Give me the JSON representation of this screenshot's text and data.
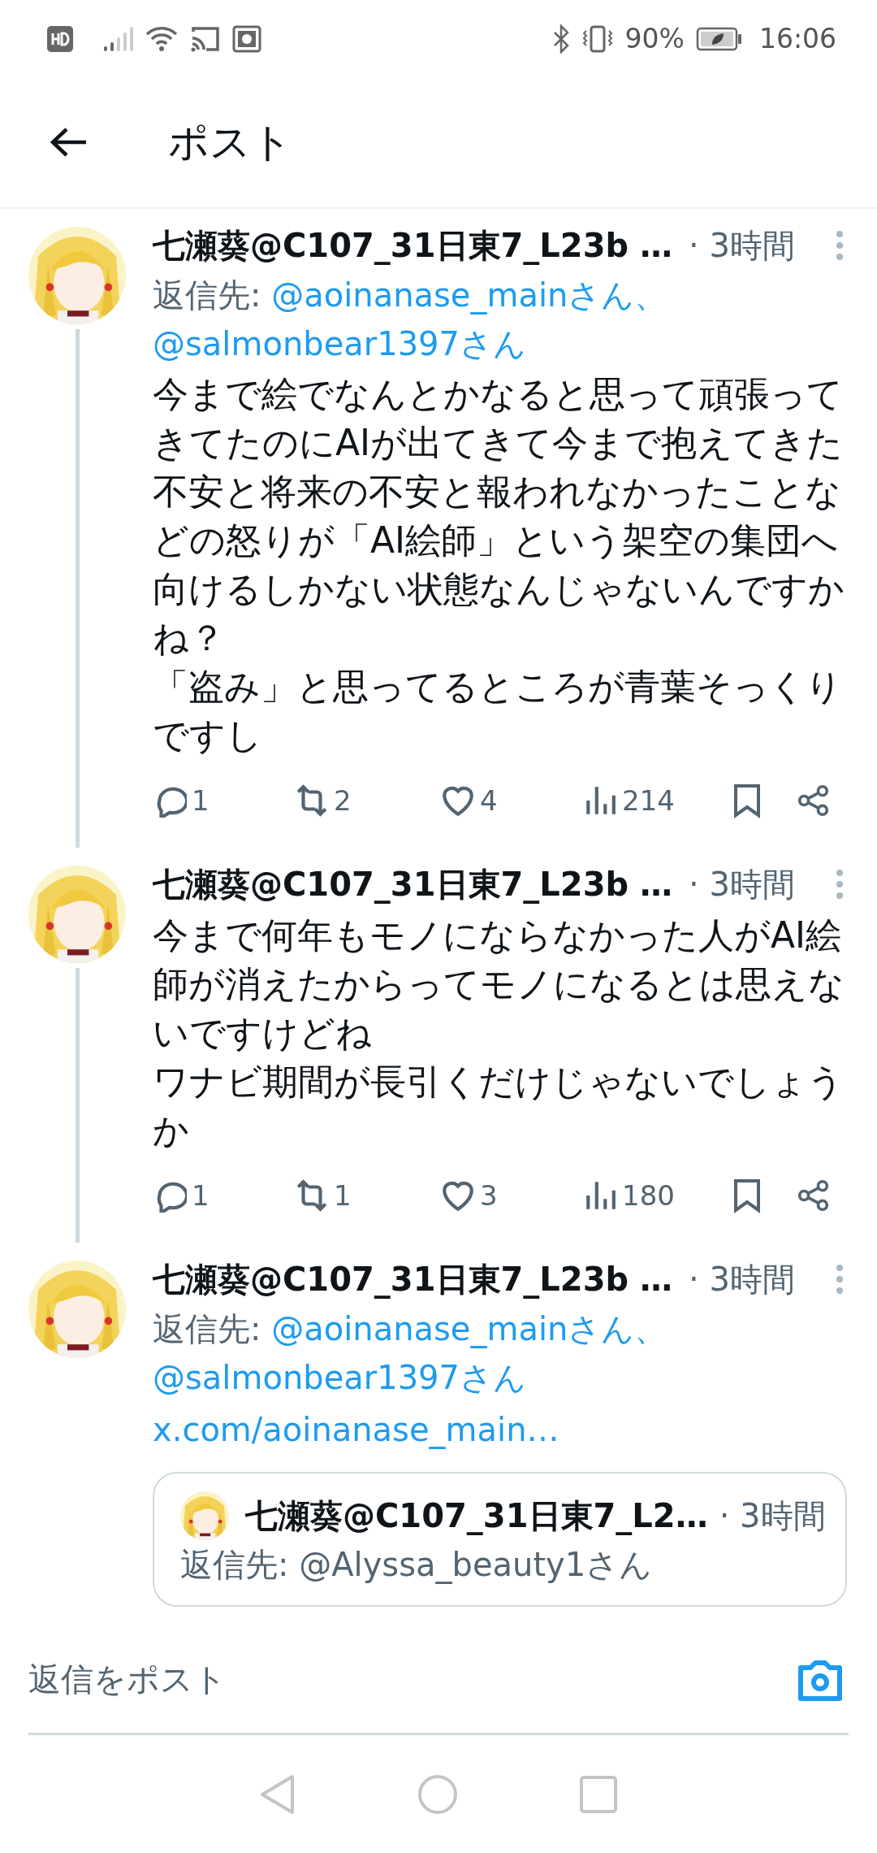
{
  "status_bar": {
    "battery": "90%",
    "time": "16:06"
  },
  "header": {
    "title": "ポスト"
  },
  "posts": [
    {
      "author": "七瀬葵@C107_31日東7_L23b …",
      "time": "· 3時間",
      "reply_label": "返信先:",
      "mentions": [
        "@aoinanase_mainさん、",
        "@salmonbear1397さん"
      ],
      "text": [
        "今まで絵でなんとかなると思って頑張ってきてたのにAIが出てきて今まで抱えてきた不安と将来の不安と報われなかったことなどの怒りが「AI絵師」という架空の集団へ向けるしかない状態なんじゃないんですかね？",
        "「盗み」と思ってるところが青葉そっくりですし"
      ],
      "stats": {
        "replies": "1",
        "reposts": "2",
        "likes": "4",
        "views": "214"
      },
      "connected": true
    },
    {
      "author": "七瀬葵@C107_31日東7_L23b …",
      "time": "· 3時間",
      "text": [
        "今まで何年もモノにならなかった人がAI絵師が消えたからってモノになるとは思えないですけどね",
        "ワナビ期間が長引くだけじゃないでしょうか"
      ],
      "stats": {
        "replies": "1",
        "reposts": "1",
        "likes": "3",
        "views": "180"
      },
      "connected": true
    },
    {
      "author": "七瀬葵@C107_31日東7_L23b …",
      "time": "· 3時間",
      "reply_label": "返信先:",
      "mentions": [
        "@aoinanase_mainさん、",
        "@salmonbear1397さん"
      ],
      "link": "x.com/aoinanase_main…",
      "quote": {
        "author": "七瀬葵@C107_31日東7_L2…",
        "time": "· 3時間",
        "reply_to": "返信先: @Alyssa_beauty1さん"
      },
      "connected": false
    }
  ],
  "composer": {
    "placeholder": "返信をポスト"
  }
}
